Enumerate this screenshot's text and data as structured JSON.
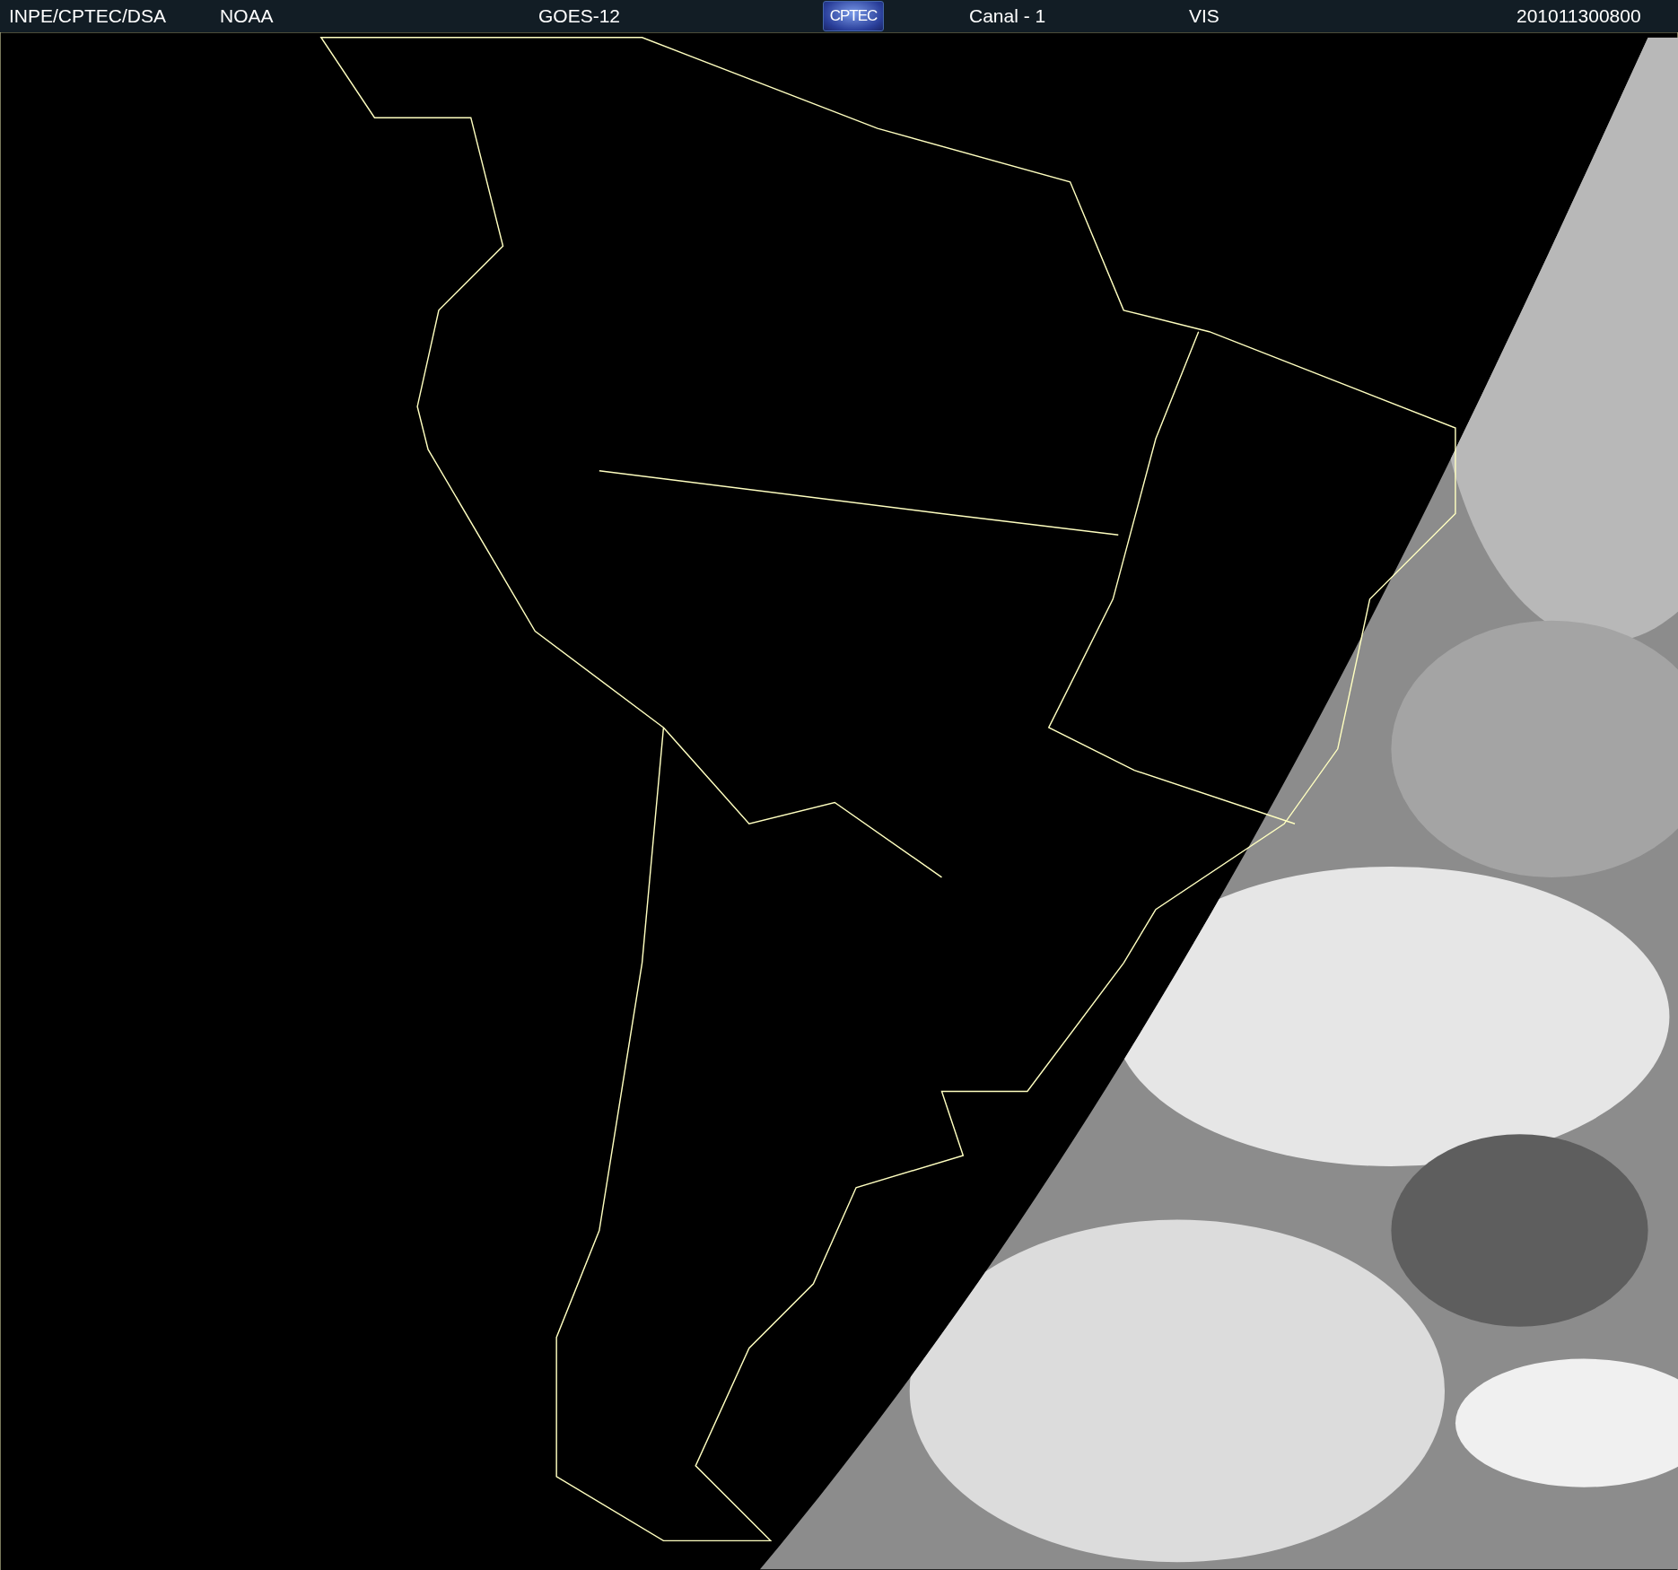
{
  "header": {
    "items": [
      {
        "kind": "text",
        "text": "INPE/CPTEC/DSA"
      },
      {
        "kind": "text",
        "text": "NOAA"
      },
      {
        "kind": "text",
        "text": "GOES-12"
      },
      {
        "kind": "logo",
        "text": "CPTEC"
      },
      {
        "kind": "text",
        "text": "Canal - 1"
      },
      {
        "kind": "text",
        "text": "VIS"
      },
      {
        "kind": "text",
        "text": "201011300800"
      }
    ]
  }
}
